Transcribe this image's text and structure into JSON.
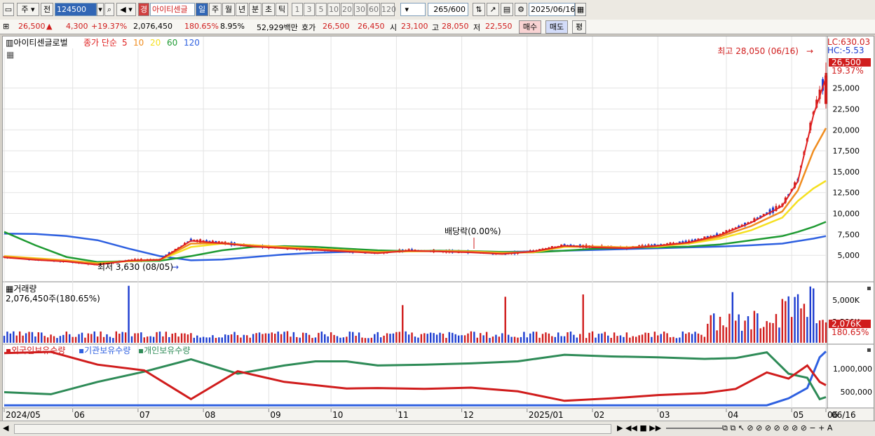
{
  "toolbar": {
    "market": "주",
    "prev": "전",
    "code": "124500",
    "badge": "경",
    "name": "아이티센글",
    "periods": [
      "일",
      "주",
      "월",
      "년",
      "분",
      "초",
      "틱"
    ],
    "mins": [
      "1",
      "3",
      "5",
      "10",
      "20",
      "30",
      "60",
      "120"
    ],
    "count": "265",
    "count_total": "/600",
    "date": "2025/06/16"
  },
  "quote": {
    "price": "26,500",
    "change": "4,300",
    "change_pct": "+19.37%",
    "volume": "2,076,450",
    "vol_ratio": "180.65%",
    "turnover": "8.95%",
    "amount": "52,929백만",
    "hoga_label": "호가",
    "ask": "26,500",
    "bid": "26,450",
    "open_label": "시",
    "open": "23,100",
    "high_label": "고",
    "high": "28,050",
    "low_label": "저",
    "low": "22,550",
    "buy_btn": "매수",
    "sell_btn": "매도",
    "eval_btn": "평"
  },
  "colors": {
    "up": "#d01c1c",
    "down": "#1c3cd0",
    "ma5": "#e02020",
    "ma10": "#f08c1e",
    "ma20": "#f5e020",
    "ma60": "#1e9a32",
    "ma120": "#2e60e0",
    "foreign": "#d01c1c",
    "inst": "#2e60e0",
    "indiv": "#2e8b57"
  },
  "chart_data": [
    {
      "type": "line",
      "title": "아이티센글로벌",
      "legend": {
        "label": "종가 단순",
        "periods": [
          "5",
          "10",
          "20",
          "60",
          "120"
        ]
      },
      "y_ticks": [
        "25,000",
        "22,500",
        "20,000",
        "17,500",
        "15,000",
        "12,500",
        "10,000",
        "7,500",
        "5,000"
      ],
      "ylim": [
        2000,
        30500
      ],
      "x_ticks": [
        "2024/05",
        "06",
        "07",
        "08",
        "09",
        "10",
        "11",
        "12",
        "2025/01",
        "02",
        "03",
        "04",
        "05",
        "06",
        "06/16"
      ],
      "right_labels": {
        "lc": "LC:630.03",
        "hc": "HC:-5.53",
        "price": "26,500",
        "pct": "19.37%"
      },
      "annotations": {
        "high": "최고 28,050 (06/16)",
        "low": "최저 3,630 (08/05)",
        "dividend": "배당락(0.00%)"
      },
      "x": [
        0,
        10,
        20,
        30,
        40,
        50,
        60,
        70,
        80,
        90,
        100,
        110,
        120,
        130,
        140,
        150,
        160,
        170,
        180,
        190,
        200,
        210,
        220,
        230,
        240,
        250,
        255,
        260,
        264
      ],
      "close": [
        4800,
        4500,
        4300,
        3900,
        4400,
        4500,
        6800,
        6500,
        6100,
        5900,
        5700,
        5500,
        5300,
        5600,
        5500,
        5400,
        5200,
        5500,
        6200,
        6000,
        5900,
        6200,
        6600,
        7500,
        9000,
        11000,
        14000,
        22000,
        26500
      ],
      "ma20": [
        4900,
        4650,
        4400,
        4050,
        4300,
        4450,
        6000,
        6400,
        6200,
        6000,
        5800,
        5600,
        5400,
        5450,
        5500,
        5450,
        5300,
        5350,
        6000,
        6050,
        5950,
        6050,
        6400,
        7000,
        8000,
        9500,
        11500,
        13000,
        13900
      ],
      "ma60": [
        7800,
        6200,
        4800,
        4200,
        4300,
        4350,
        4900,
        5600,
        6000,
        6100,
        6000,
        5800,
        5600,
        5500,
        5550,
        5500,
        5400,
        5350,
        5550,
        5800,
        5900,
        5950,
        6050,
        6300,
        6800,
        7300,
        7800,
        8400,
        9000
      ],
      "ma120": [
        7600,
        7550,
        7300,
        6800,
        5800,
        4900,
        4400,
        4500,
        4800,
        5100,
        5300,
        5400,
        5450,
        5500,
        5500,
        5450,
        5400,
        5450,
        5550,
        5650,
        5750,
        5850,
        5950,
        6050,
        6200,
        6400,
        6700,
        7000,
        7300
      ]
    },
    {
      "type": "bar",
      "title": "거래량",
      "value_label": "2,076,450주(180.65%)",
      "y_ticks": [
        "5,000K",
        "2,500K"
      ],
      "right_labels": {
        "value": "2,076K",
        "pct": "180.65%"
      }
    },
    {
      "type": "line",
      "series_names": [
        "외국인보유수량",
        "기관보유수량",
        "개인보유수량"
      ],
      "y_ticks": [
        "1,000,000",
        "500,000"
      ],
      "x": [
        0,
        15,
        30,
        45,
        60,
        75,
        90,
        100,
        110,
        120,
        135,
        150,
        165,
        180,
        195,
        210,
        225,
        235,
        245,
        252,
        258,
        262,
        264
      ],
      "foreign": [
        1300000,
        1330000,
        1020000,
        880000,
        180000,
        860000,
        600000,
        520000,
        440000,
        450000,
        430000,
        460000,
        370000,
        140000,
        200000,
        280000,
        330000,
        430000,
        830000,
        680000,
        1000000,
        600000,
        520000
      ],
      "inst": [
        30000,
        30000,
        30000,
        30000,
        30000,
        30000,
        30000,
        30000,
        30000,
        30000,
        30000,
        30000,
        30000,
        30000,
        30000,
        30000,
        30000,
        30000,
        30000,
        200000,
        450000,
        1200000,
        1340000
      ],
      "indiv": [
        350000,
        300000,
        600000,
        850000,
        1150000,
        800000,
        1000000,
        1100000,
        1100000,
        1000000,
        1020000,
        1050000,
        1100000,
        1260000,
        1220000,
        1200000,
        1160000,
        1180000,
        1320000,
        800000,
        700000,
        180000,
        230000
      ]
    }
  ],
  "status": {
    "controls": "▶ ◀◀ ■ ▶▶"
  }
}
